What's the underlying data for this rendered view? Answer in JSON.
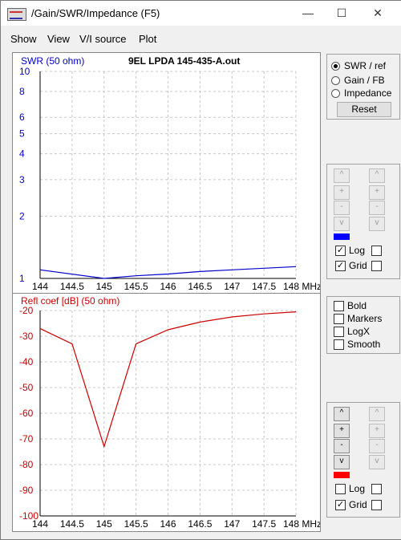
{
  "window": {
    "title": "/Gain/SWR/Impedance (F5)",
    "minimize_icon": "minimize-icon",
    "maximize_icon": "maximize-icon",
    "close_icon": "close-icon"
  },
  "menu": [
    "Show",
    "View",
    "V/I source",
    "Plot"
  ],
  "plot_title": "9EL LPDA 145-435-A.out",
  "swr_radio": {
    "options": [
      "SWR / ref",
      "Gain / FB",
      "Impedance"
    ],
    "selected": "SWR / ref",
    "reset_label": "Reset"
  },
  "top_controls": {
    "step_buttons": [
      "^",
      "^",
      "+",
      "+",
      "-",
      "-",
      "v",
      "v"
    ],
    "color": "#0000ff",
    "log_label": "Log",
    "log_checked": true,
    "grid_label": "Grid",
    "grid_checked": true
  },
  "mid_options": [
    {
      "label": "Bold",
      "checked": false
    },
    {
      "label": "Markers",
      "checked": false
    },
    {
      "label": "LogX",
      "checked": false
    },
    {
      "label": "Smooth",
      "checked": false
    }
  ],
  "bottom_controls": {
    "step_buttons": [
      "^",
      "^",
      "+",
      "+",
      "-",
      "-",
      "v",
      "v"
    ],
    "color": "#ff0000",
    "log_label": "Log",
    "log_checked": false,
    "grid_label": "Grid",
    "grid_checked": true
  },
  "chart_data": [
    {
      "type": "line",
      "ylabel": "SWR (50 ohm)",
      "x_ticks": [
        "144",
        "144.5",
        "145",
        "145.5",
        "146",
        "146.5",
        "147",
        "147.5",
        "148 MHz"
      ],
      "y_ticks": [
        "10",
        "8",
        "6",
        "5",
        "4",
        "3",
        "2",
        "1"
      ],
      "y_scale": "log",
      "xlim": [
        144,
        148
      ],
      "ylim": [
        1,
        10
      ],
      "grid": true,
      "color": "#0000cc",
      "series": [
        {
          "x": [
            144,
            145,
            145.5,
            146,
            146.5,
            147,
            147.5,
            148
          ],
          "y": [
            1.1,
            1.0,
            1.03,
            1.05,
            1.08,
            1.1,
            1.12,
            1.14
          ]
        }
      ]
    },
    {
      "type": "line",
      "ylabel": "Refl coef [dB] (50 ohm)",
      "x_ticks": [
        "144",
        "144.5",
        "145",
        "145.5",
        "146",
        "146.5",
        "147",
        "147.5",
        "148 MHz"
      ],
      "y_ticks": [
        "-20",
        "-30",
        "-40",
        "-50",
        "-60",
        "-70",
        "-80",
        "-90",
        "-100"
      ],
      "xlim": [
        144,
        148
      ],
      "ylim": [
        -100,
        -20
      ],
      "grid": true,
      "color": "#cc0000",
      "series": [
        {
          "x": [
            144,
            144.5,
            145,
            145.5,
            146,
            146.5,
            147,
            147.5,
            148
          ],
          "y": [
            -27,
            -33,
            -73,
            -33,
            -27.5,
            -24.5,
            -22.5,
            -21.3,
            -20.5
          ]
        }
      ]
    }
  ]
}
